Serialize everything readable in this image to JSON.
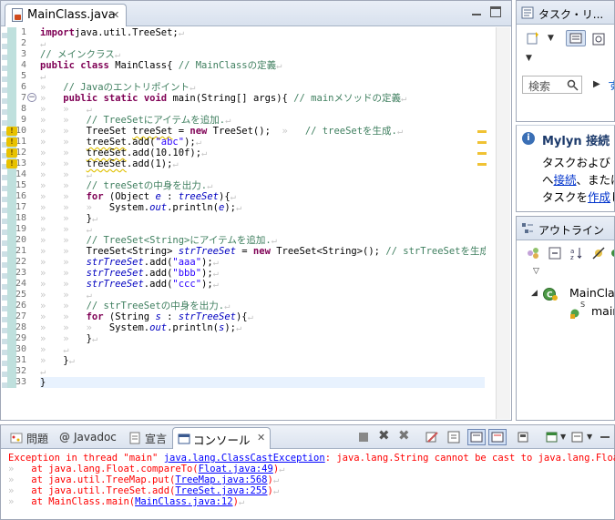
{
  "editor": {
    "tab_label": "MainClass.java",
    "close_glyph": "✕",
    "lines": [
      {
        "n": "1",
        "segs": [
          [
            "kw",
            "import"
          ],
          [
            "",
            "java.util.TreeSet;"
          ],
          [
            "wsp",
            "↵"
          ]
        ]
      },
      {
        "n": "2",
        "segs": [
          [
            "wsp",
            "↵"
          ]
        ]
      },
      {
        "n": "3",
        "segs": [
          [
            "cm",
            "// メインクラス"
          ],
          [
            "wsp",
            "↵"
          ]
        ]
      },
      {
        "n": "4",
        "segs": [
          [
            "kw",
            "public"
          ],
          [
            "",
            " "
          ],
          [
            "kw",
            "class"
          ],
          [
            "",
            " MainClass{"
          ],
          [
            "cm",
            " // MainClassの定義"
          ],
          [
            "wsp",
            "↵"
          ]
        ]
      },
      {
        "n": "5",
        "segs": [
          [
            "wsp",
            "↵"
          ]
        ]
      },
      {
        "n": "6",
        "segs": [
          [
            "wsp",
            "»   "
          ],
          [
            "cm",
            "// Javaのエントリポイント"
          ],
          [
            "wsp",
            "↵"
          ]
        ]
      },
      {
        "n": "7",
        "segs": [
          [
            "wsp",
            "»   "
          ],
          [
            "kw",
            "public"
          ],
          [
            "",
            " "
          ],
          [
            "kw",
            "static"
          ],
          [
            "",
            " "
          ],
          [
            "kw",
            "void"
          ],
          [
            "",
            " main(String[] args){"
          ],
          [
            "cm",
            " // mainメソッドの定義"
          ],
          [
            "wsp",
            "↵"
          ]
        ]
      },
      {
        "n": "8",
        "segs": [
          [
            "wsp",
            "»   »   ↵"
          ]
        ]
      },
      {
        "n": "9",
        "segs": [
          [
            "wsp",
            "»   »   "
          ],
          [
            "cm",
            "// TreeSetにアイテムを追加."
          ],
          [
            "wsp",
            "↵"
          ]
        ]
      },
      {
        "n": "10",
        "segs": [
          [
            "wsp",
            "»   »   "
          ],
          [
            "",
            "TreeSet "
          ],
          [
            "err",
            "treeSet"
          ],
          [
            "",
            " = "
          ],
          [
            "kw",
            "new"
          ],
          [
            "",
            " TreeSet();"
          ],
          [
            "wsp",
            "  »   "
          ],
          [
            "cm",
            "// treeSetを生成."
          ],
          [
            "wsp",
            "↵"
          ]
        ]
      },
      {
        "n": "11",
        "segs": [
          [
            "wsp",
            "»   »   "
          ],
          [
            "err",
            "treeSet"
          ],
          [
            "",
            ".add("
          ],
          [
            "st",
            "\"abc\""
          ],
          [
            "",
            ");"
          ],
          [
            "wsp",
            "↵"
          ]
        ]
      },
      {
        "n": "12",
        "segs": [
          [
            "wsp",
            "»   »   "
          ],
          [
            "err",
            "treeSet"
          ],
          [
            "",
            ".add(10.10f);"
          ],
          [
            "wsp",
            "↵"
          ]
        ]
      },
      {
        "n": "13",
        "segs": [
          [
            "wsp",
            "»   »   "
          ],
          [
            "err",
            "treeSet"
          ],
          [
            "",
            ".add(1);"
          ],
          [
            "wsp",
            "↵"
          ]
        ]
      },
      {
        "n": "14",
        "segs": [
          [
            "wsp",
            "»   »   ↵"
          ]
        ]
      },
      {
        "n": "15",
        "segs": [
          [
            "wsp",
            "»   »   "
          ],
          [
            "cm",
            "// treeSetの中身を出力."
          ],
          [
            "wsp",
            "↵"
          ]
        ]
      },
      {
        "n": "16",
        "segs": [
          [
            "wsp",
            "»   »   "
          ],
          [
            "kw",
            "for"
          ],
          [
            "",
            " (Object "
          ],
          [
            "fd",
            "e"
          ],
          [
            "",
            " : "
          ],
          [
            "fd",
            "treeSet"
          ],
          [
            "",
            "){"
          ],
          [
            "wsp",
            "↵"
          ]
        ]
      },
      {
        "n": "17",
        "segs": [
          [
            "wsp",
            "»   »   »   "
          ],
          [
            "",
            "System."
          ],
          [
            "fd",
            "out"
          ],
          [
            "",
            ".println("
          ],
          [
            "fd",
            "e"
          ],
          [
            "",
            ");"
          ],
          [
            "wsp",
            "↵"
          ]
        ]
      },
      {
        "n": "18",
        "segs": [
          [
            "wsp",
            "»   »   "
          ],
          [
            "",
            "}"
          ],
          [
            "wsp",
            "↵"
          ]
        ]
      },
      {
        "n": "19",
        "segs": [
          [
            "wsp",
            "»   »   ↵"
          ]
        ]
      },
      {
        "n": "20",
        "segs": [
          [
            "wsp",
            "»   »   "
          ],
          [
            "cm",
            "// TreeSet<String>にアイテムを追加."
          ],
          [
            "wsp",
            "↵"
          ]
        ]
      },
      {
        "n": "21",
        "segs": [
          [
            "wsp",
            "»   »   "
          ],
          [
            "",
            "TreeSet<String> "
          ],
          [
            "fd",
            "strTreeSet"
          ],
          [
            "",
            " = "
          ],
          [
            "kw",
            "new"
          ],
          [
            "",
            " TreeSet<String>();"
          ],
          [
            "cm",
            " // strTreeSetを生成."
          ],
          [
            "wsp",
            "↵"
          ]
        ]
      },
      {
        "n": "22",
        "segs": [
          [
            "wsp",
            "»   »   "
          ],
          [
            "fd",
            "strTreeSet"
          ],
          [
            "",
            ".add("
          ],
          [
            "st",
            "\"aaa\""
          ],
          [
            "",
            ");"
          ],
          [
            "wsp",
            "↵"
          ]
        ]
      },
      {
        "n": "23",
        "segs": [
          [
            "wsp",
            "»   »   "
          ],
          [
            "fd",
            "strTreeSet"
          ],
          [
            "",
            ".add("
          ],
          [
            "st",
            "\"bbb\""
          ],
          [
            "",
            ");"
          ],
          [
            "wsp",
            "↵"
          ]
        ]
      },
      {
        "n": "24",
        "segs": [
          [
            "wsp",
            "»   »   "
          ],
          [
            "fd",
            "strTreeSet"
          ],
          [
            "",
            ".add("
          ],
          [
            "st",
            "\"ccc\""
          ],
          [
            "",
            ");"
          ],
          [
            "wsp",
            "↵"
          ]
        ]
      },
      {
        "n": "25",
        "segs": [
          [
            "wsp",
            "»   »   ↵"
          ]
        ]
      },
      {
        "n": "26",
        "segs": [
          [
            "wsp",
            "»   »   "
          ],
          [
            "cm",
            "// strTreeSetの中身を出力."
          ],
          [
            "wsp",
            "↵"
          ]
        ]
      },
      {
        "n": "27",
        "segs": [
          [
            "wsp",
            "»   »   "
          ],
          [
            "kw",
            "for"
          ],
          [
            "",
            " (String "
          ],
          [
            "fd",
            "s"
          ],
          [
            "",
            " : "
          ],
          [
            "fd",
            "strTreeSet"
          ],
          [
            "",
            "){"
          ],
          [
            "wsp",
            "↵"
          ]
        ]
      },
      {
        "n": "28",
        "segs": [
          [
            "wsp",
            "»   »   »   "
          ],
          [
            "",
            "System."
          ],
          [
            "fd",
            "out"
          ],
          [
            "",
            ".println("
          ],
          [
            "fd",
            "s"
          ],
          [
            "",
            ");"
          ],
          [
            "wsp",
            "↵"
          ]
        ]
      },
      {
        "n": "29",
        "segs": [
          [
            "wsp",
            "»   »   "
          ],
          [
            "",
            "}"
          ],
          [
            "wsp",
            "↵"
          ]
        ]
      },
      {
        "n": "30",
        "segs": [
          [
            "wsp",
            "»   ↵"
          ]
        ]
      },
      {
        "n": "31",
        "segs": [
          [
            "wsp",
            "»   "
          ],
          [
            "",
            "}"
          ],
          [
            "wsp",
            "↵"
          ]
        ]
      },
      {
        "n": "32",
        "segs": [
          [
            "wsp",
            "↵"
          ]
        ]
      },
      {
        "n": "33",
        "segs": [
          [
            "",
            "}"
          ]
        ]
      }
    ],
    "warning_lines": [
      "10",
      "11",
      "12",
      "13"
    ]
  },
  "task_view": {
    "title": "タスク・リ...",
    "search_placeholder": "検索",
    "next_glyph": "▶",
    "next_text": "す"
  },
  "mylyn": {
    "title": "Mylyn 接続",
    "line1": "タスクおよび",
    "line2_prefix": "へ",
    "line2_link": "接続",
    "line2_suffix": "、または",
    "line3_prefix": "タスクを",
    "line3_link": "作成",
    "line3_suffix": "し"
  },
  "outline": {
    "title": "アウトライン",
    "class_item": "MainClas",
    "method_item": "main",
    "static_marker": "S"
  },
  "console": {
    "tabs": {
      "problems": "問題",
      "javadoc": "Javadoc",
      "declaration": "宣言",
      "console": "コンソール"
    },
    "close_glyph": "✕",
    "output": [
      [
        [
          "",
          "Exception in thread \"main\" "
        ],
        [
          "lnk",
          "java.lang.ClassCastException"
        ],
        [
          "",
          ": java.lang.String cannot be cast to java.lang.Float"
        ],
        [
          "wsp",
          "↵"
        ]
      ],
      [
        [
          "wsp",
          "»   "
        ],
        [
          "",
          "at java.lang.Float.compareTo("
        ],
        [
          "lnk",
          "Float.java:49"
        ],
        [
          "",
          ")"
        ],
        [
          "wsp",
          "↵"
        ]
      ],
      [
        [
          "wsp",
          "»   "
        ],
        [
          "",
          "at java.util.TreeMap.put("
        ],
        [
          "lnk",
          "TreeMap.java:568"
        ],
        [
          "",
          ")"
        ],
        [
          "wsp",
          "↵"
        ]
      ],
      [
        [
          "wsp",
          "»   "
        ],
        [
          "",
          "at java.util.TreeSet.add("
        ],
        [
          "lnk",
          "TreeSet.java:255"
        ],
        [
          "",
          ")"
        ],
        [
          "wsp",
          "↵"
        ]
      ],
      [
        [
          "wsp",
          "»   "
        ],
        [
          "",
          "at MainClass.main("
        ],
        [
          "lnk",
          "MainClass.java:12"
        ],
        [
          "",
          ")"
        ],
        [
          "wsp",
          "↵"
        ]
      ]
    ]
  },
  "colors": {
    "keyword": "#7f0055",
    "comment": "#3f7f5f",
    "string": "#2a00ff",
    "field": "#0000c0",
    "error_output": "#ff0000",
    "link": "#0000ff"
  }
}
